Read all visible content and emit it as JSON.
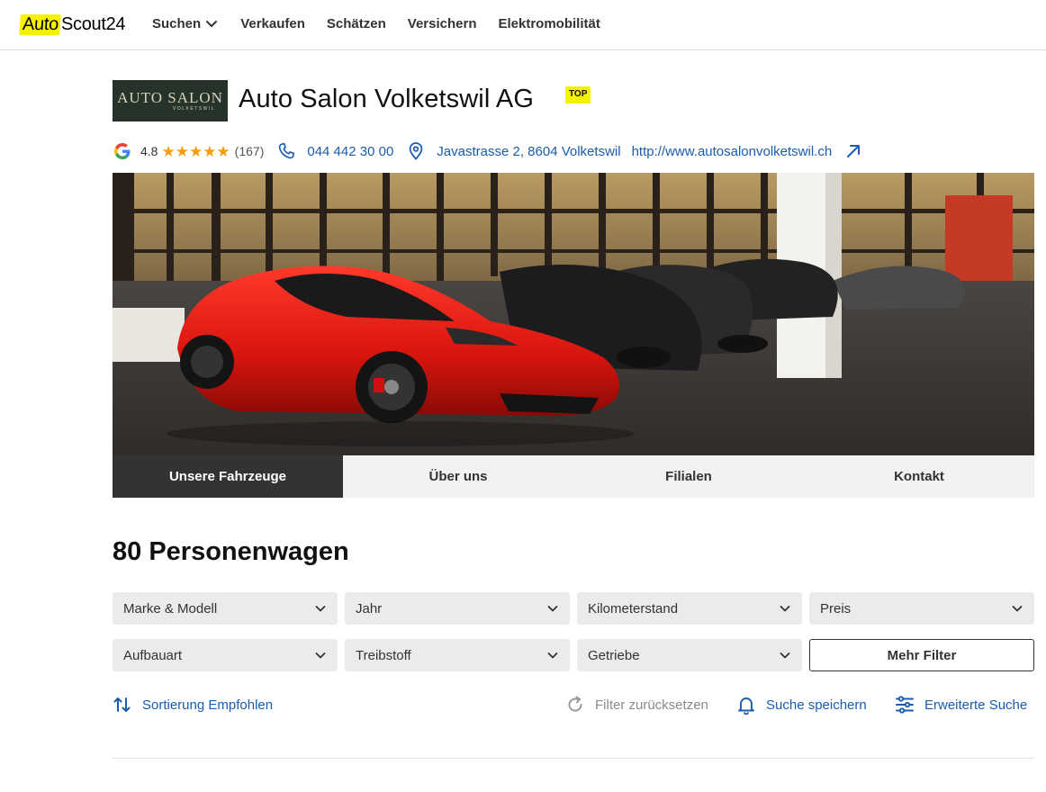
{
  "header": {
    "logo_part1": "Auto",
    "logo_part2": "Scout24",
    "nav": [
      {
        "label": "Suchen",
        "icon": "chevron-down-icon"
      },
      {
        "label": "Verkaufen"
      },
      {
        "label": "Schätzen"
      },
      {
        "label": "Versichern"
      },
      {
        "label": "Elektromobilität"
      }
    ]
  },
  "dealer": {
    "logo_line1": "AUTO SALON",
    "logo_line2": "VOLKETSWIL",
    "name": "Auto Salon Volketswil AG",
    "badge": "TOP",
    "rating": "4.8",
    "stars": 5,
    "stars_text": "★★★★★",
    "reviews": "(167)",
    "phone": "044 442 30 00",
    "address": "Javastrasse 2, 8604 Volketswil",
    "website": "http://www.autosalonvolketswil.ch"
  },
  "tabs": [
    {
      "label": "Unsere Fahrzeuge",
      "active": true
    },
    {
      "label": "Über uns",
      "active": false
    },
    {
      "label": "Filialen",
      "active": false
    },
    {
      "label": "Kontakt",
      "active": false
    }
  ],
  "results": {
    "title": "80 Personenwagen"
  },
  "filters": {
    "row1": [
      "Marke & Modell",
      "Jahr",
      "Kilometerstand",
      "Preis"
    ],
    "row2": [
      "Aufbauart",
      "Treibstoff",
      "Getriebe"
    ],
    "more_label": "Mehr Filter"
  },
  "actions": {
    "sort": "Sortierung Empfohlen",
    "reset": "Filter zurücksetzen",
    "save": "Suche speichern",
    "extended": "Erweiterte Suche"
  },
  "colors": {
    "brand_yellow": "#f5f200",
    "link_blue": "#1a5cb0",
    "active_tab": "#333333",
    "star": "#f39c12"
  }
}
